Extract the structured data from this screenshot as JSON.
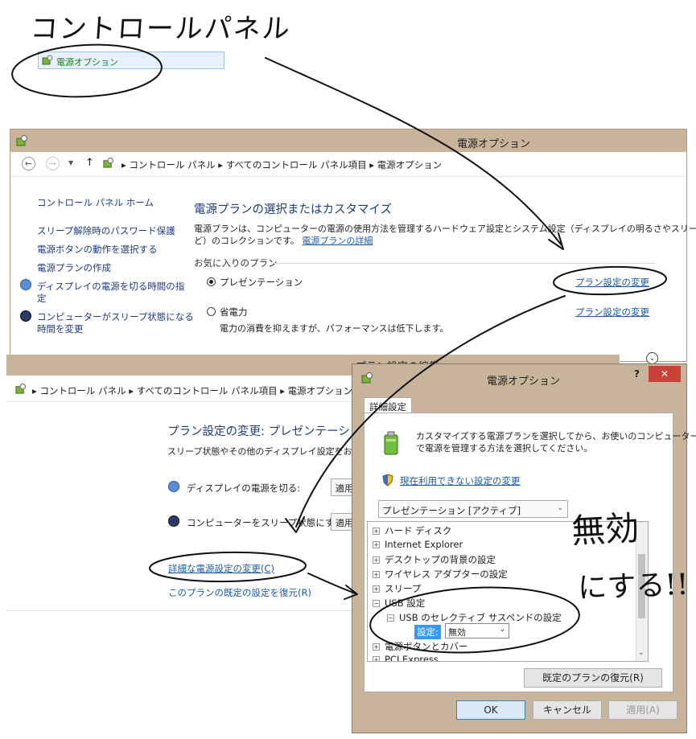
{
  "annotations": {
    "top_title": "コントロールパネル",
    "right_note_1": "無効",
    "right_note_2": "にする!!"
  },
  "control_panel_item": {
    "label": "電源オプション"
  },
  "window1": {
    "title": "電源オプション",
    "breadcrumbs": [
      "コントロール パネル",
      "すべてのコントロール パネル項目",
      "電源オプション"
    ],
    "sidebar": {
      "home": "コントロール パネル ホーム",
      "items": [
        "スリープ解除時のパスワード保護",
        "電源ボタンの動作を選択する",
        "電源プランの作成",
        "ディスプレイの電源を切る時間の指",
        "定",
        "コンピューターがスリープ状態になる",
        "時間を変更"
      ]
    },
    "heading": "電源プランの選択またはカスタマイズ",
    "desc_line1": "電源プランは、コンピューターの電源の使用方法を管理するハードウェア設定とシステム設定（ディスプレイの明るさやスリープな",
    "desc_line2": "ど）のコレクションです。",
    "desc_link": "電源プランの詳細",
    "fav_label": "お気に入りのプラン",
    "plans": [
      {
        "name": "プレゼンテーション",
        "selected": true,
        "link": "プラン設定の変更"
      },
      {
        "name": "省電力",
        "selected": false,
        "link": "プラン設定の変更",
        "desc": "電力の消費を抑えますが、パフォーマンスは低下します。"
      }
    ]
  },
  "window2": {
    "title_partial": "プラン設定の編集",
    "breadcrumbs": [
      "コントロール パネル",
      "すべてのコントロール パネル項目",
      "電源オプション",
      "プ"
    ],
    "heading": "プラン設定の変更: プレゼンテーショ",
    "subtext": "スリープ状態やその他のディスプレイ設定をお使い",
    "display_off_label": "ディスプレイの電源を切る:",
    "display_off_value": "適用",
    "sleep_label": "コンピューターをスリープ状態にする:",
    "sleep_value": "適用",
    "advanced_link": "詳細な電源設定の変更(C)",
    "restore_link": "このプランの既定の設定を復元(R)"
  },
  "dialog": {
    "title": "電源オプション",
    "help": "?",
    "close": "✕",
    "tab": "詳細設定",
    "intro_line1": "カスタマイズする電源プランを選択してから、お使いのコンピューター",
    "intro_line2": "で電源を管理する方法を選択してください。",
    "unavailable_link": "現在利用できない設定の変更",
    "plan_select": "プレゼンテーション [アクティブ]",
    "tree": [
      "ハード ディスク",
      "Internet Explorer",
      "デスクトップの背景の設定",
      "ワイヤレス アダプターの設定",
      "スリープ",
      "USB 設定",
      "USB のセレクティブ サスペンドの設定",
      "電源ボタンとカバー",
      "PCI Express"
    ],
    "setting_label": "設定:",
    "setting_value": "無効",
    "restore_button": "既定のプランの復元(R)",
    "ok": "OK",
    "cancel": "キャンセル",
    "apply": "適用(A)"
  }
}
